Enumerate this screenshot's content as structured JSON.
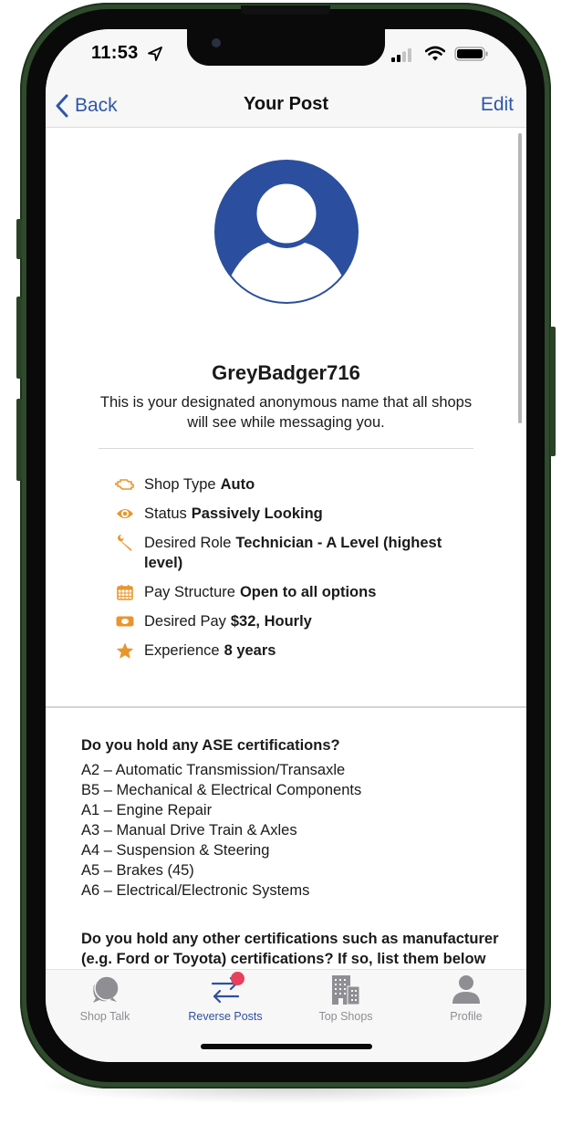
{
  "status_bar": {
    "time": "11:53",
    "icons": [
      "location-arrow-icon",
      "cellular-signal-icon",
      "wifi-icon",
      "battery-icon"
    ]
  },
  "nav": {
    "back_label": "Back",
    "title": "Your Post",
    "edit_label": "Edit"
  },
  "profile": {
    "username": "GreyBadger716",
    "description": "This is your designated anonymous name that all shops will see while messaging you."
  },
  "details": [
    {
      "icon": "engine-icon",
      "label": "Shop Type",
      "value": "Auto"
    },
    {
      "icon": "eye-icon",
      "label": "Status",
      "value": "Passively Looking"
    },
    {
      "icon": "wrench-icon",
      "label": "Desired Role",
      "value": "Technician - A Level (highest level)"
    },
    {
      "icon": "calendar-icon",
      "label": "Pay Structure",
      "value": "Open to all options"
    },
    {
      "icon": "money-icon",
      "label": "Desired Pay",
      "value": "$32, Hourly"
    },
    {
      "icon": "star-icon",
      "label": "Experience",
      "value": "8 years"
    }
  ],
  "ase": {
    "question": "Do you hold any ASE certifications?",
    "items": [
      "A2 – Automatic Transmission/Transaxle",
      "B5 – Mechanical & Electrical Components",
      "A1 – Engine Repair",
      "A3 – Manual Drive Train & Axles",
      "A4 – Suspension & Steering",
      "A5 – Brakes (45)",
      "A6 – Electrical/Electronic Systems"
    ]
  },
  "other_certs": {
    "question": "Do you hold any other certifications such as manufacturer (e.g. Ford or Toyota) certifications? If so, list them below"
  },
  "tabs": [
    {
      "label": "Shop Talk",
      "icon": "chat-bubbles-icon",
      "active": false
    },
    {
      "label": "Reverse Posts",
      "icon": "swap-arrows-icon",
      "active": true,
      "badge": true
    },
    {
      "label": "Top Shops",
      "icon": "buildings-icon",
      "active": false
    },
    {
      "label": "Profile",
      "icon": "person-icon",
      "active": false
    }
  ],
  "colors": {
    "accent": "#2f56a8",
    "avatar": "#2b4f9e",
    "detail_icon": "#e8962c",
    "badge": "#e8405a",
    "phone_frame": "#2f4a2c"
  }
}
